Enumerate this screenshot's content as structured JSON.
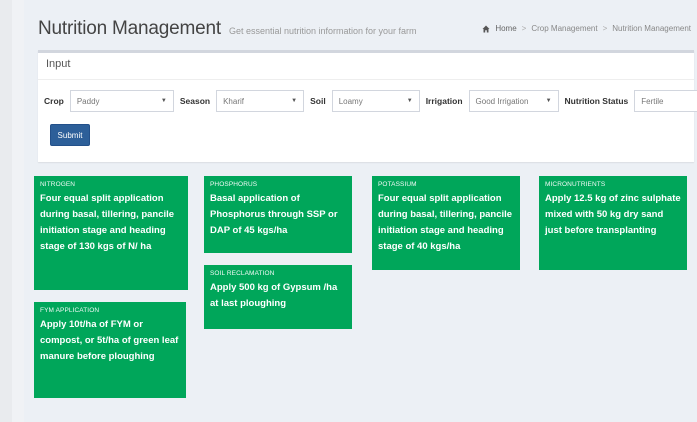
{
  "header": {
    "title": "Nutrition Management",
    "subtitle": "Get essential nutrition information for your farm"
  },
  "breadcrumb": {
    "home": "Home",
    "crop": "Crop Management",
    "current": "Nutrition Management"
  },
  "input_panel": {
    "title": "Input",
    "fields": {
      "crop": {
        "label": "Crop",
        "value": "Paddy"
      },
      "season": {
        "label": "Season",
        "value": "Kharif"
      },
      "soil": {
        "label": "Soil",
        "value": "Loamy"
      },
      "irrigation": {
        "label": "Irrigation",
        "value": "Good Irrigation"
      },
      "nutrition_status": {
        "label": "Nutrition Status",
        "value": "Fertile"
      }
    },
    "submit_label": "Submit"
  },
  "cards": {
    "nitrogen": {
      "category": "NITROGEN",
      "text": "Four equal split application during basal, tillering, pancile initiation stage and heading stage of 130 kgs of N/ ha"
    },
    "phosphorus": {
      "category": "PHOSPHORUS",
      "text": "Basal application of Phosphorus through SSP or DAP of 45 kgs/ha"
    },
    "potassium": {
      "category": "POTASSIUM",
      "text": "Four equal split application during basal, tillering, pancile initiation stage and heading stage of 40 kgs/ha"
    },
    "micronutrients": {
      "category": "MICRONUTRIENTS",
      "text": "Apply 12.5 kg of zinc sulphate mixed with 50 kg dry sand just before transplanting"
    },
    "soil_reclamation": {
      "category": "SOIL RECLAMATION",
      "text": "Apply 500 kg of Gypsum /ha at last ploughing"
    },
    "fym_application": {
      "category": "FYM APPLICATION",
      "text": "Apply 10t/ha of FYM or compost, or 5t/ha of green leaf manure before ploughing"
    }
  },
  "colors": {
    "card_green": "#00a65a",
    "submit_blue": "#2d5f99"
  }
}
